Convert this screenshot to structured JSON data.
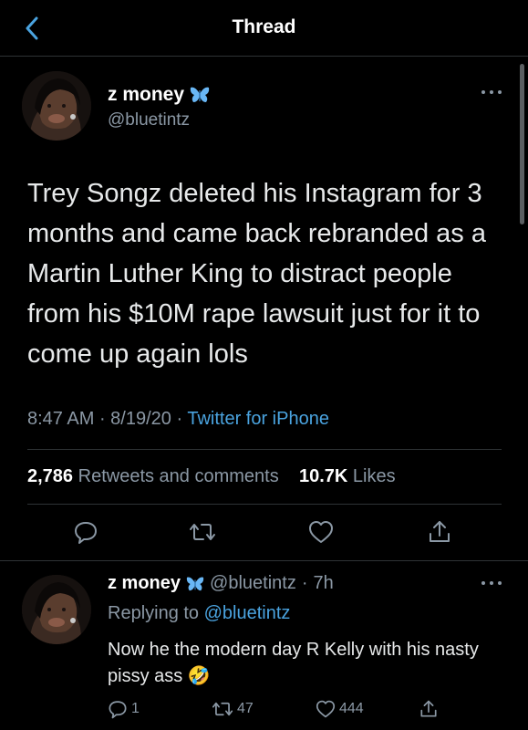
{
  "header": {
    "title": "Thread"
  },
  "tweet": {
    "name": "z money",
    "handle": "@bluetintz",
    "text": "Trey Songz deleted his Instagram for 3 months and came back rebranded as a Martin Luther King to distract people from his $10M rape lawsuit just for it to come up again lols",
    "time": "8:47 AM",
    "date": "8/19/20",
    "source": "Twitter for iPhone",
    "retweets_count": "2,786",
    "retweets_label": "Retweets and comments",
    "likes_count": "10.7K",
    "likes_label": "Likes"
  },
  "reply": {
    "name": "z money",
    "handle": "@bluetintz",
    "age": "7h",
    "replying_label": "Replying to",
    "replying_to": "@bluetintz",
    "text": "Now he the modern day R Kelly with his nasty pissy ass",
    "emoji": "🤣",
    "comments": "1",
    "retweets": "47",
    "likes": "444"
  },
  "icons": {
    "back": "chevron-left-icon",
    "badge": "butterfly-icon",
    "more": "more-icon",
    "reply": "comment-icon",
    "retweet": "retweet-icon",
    "like": "heart-icon",
    "share": "share-icon"
  },
  "colors": {
    "background": "#000000",
    "accent": "#4aa3df",
    "butterfly": "#69b7f5",
    "muted": "#8b98a5"
  }
}
